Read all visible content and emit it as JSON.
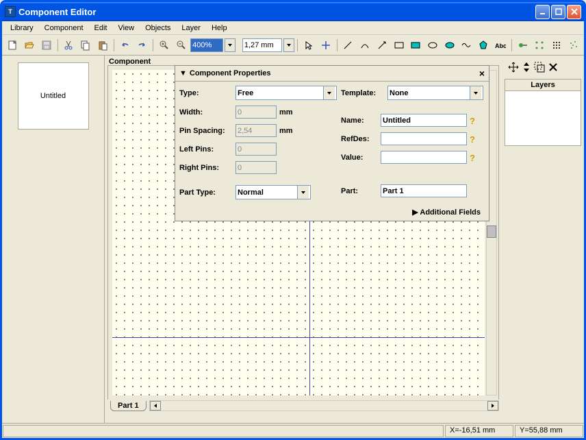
{
  "window": {
    "title": "Component Editor"
  },
  "menu": [
    "Library",
    "Component",
    "Edit",
    "View",
    "Objects",
    "Layer",
    "Help"
  ],
  "toolbar": {
    "zoom": "400%",
    "unit": "1,27 mm"
  },
  "left_panel": {
    "thumb_label": "Untitled"
  },
  "canvas": {
    "label": "Component",
    "part_tab": "Part 1"
  },
  "right_panel": {
    "layers_title": "Layers"
  },
  "props": {
    "title": "Component Properties",
    "type_label": "Type:",
    "type_value": "Free",
    "template_label": "Template:",
    "template_value": "None",
    "width_label": "Width:",
    "width_value": "0",
    "width_unit": "mm",
    "pinspacing_label": "Pin Spacing:",
    "pinspacing_value": "2,54",
    "pinspacing_unit": "mm",
    "leftpins_label": "Left Pins:",
    "leftpins_value": "0",
    "rightpins_label": "Right Pins:",
    "rightpins_value": "0",
    "name_label": "Name:",
    "name_value": "Untitled",
    "refdes_label": "RefDes:",
    "refdes_value": "",
    "value_label": "Value:",
    "value_value": "",
    "parttype_label": "Part Type:",
    "parttype_value": "Normal",
    "part_label": "Part:",
    "part_value": "Part 1",
    "additional": "Additional Fields"
  },
  "status": {
    "x": "X=-16,51 mm",
    "y": "Y=55,88 mm"
  }
}
